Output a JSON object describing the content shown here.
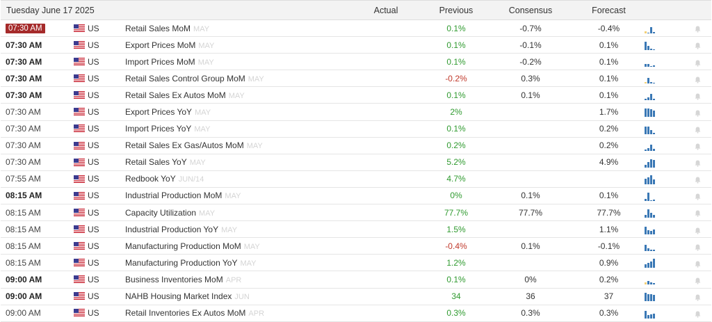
{
  "header": {
    "date": "Tuesday June 17 2025",
    "col_actual": "Actual",
    "col_previous": "Previous",
    "col_consensus": "Consensus",
    "col_forecast": "Forecast"
  },
  "colors": {
    "positive": "#2f9a2f",
    "negative": "#c0392b",
    "badge": "#a52a2a",
    "spark_blue": "#3a78b5",
    "spark_yellow": "#f2d077"
  },
  "flag_icon": "us-flag-icon",
  "bell_icon": "bell-icon",
  "rows": [
    {
      "time": "07:30 AM",
      "time_style": "badge",
      "country": "US",
      "event": "Retail Sales MoM",
      "ref": "MAY",
      "actual": "",
      "previous": "0.1%",
      "prev_sign": "pos",
      "consensus": "-0.7%",
      "forecast": "-0.4%",
      "spark": [
        3,
        0,
        9,
        2
      ]
    },
    {
      "time": "07:30 AM",
      "time_style": "bold",
      "country": "US",
      "event": "Export Prices MoM",
      "ref": "MAY",
      "actual": "",
      "previous": "0.1%",
      "prev_sign": "pos",
      "consensus": "-0.1%",
      "forecast": "0.1%",
      "spark": [
        12,
        6,
        2,
        1
      ]
    },
    {
      "time": "07:30 AM",
      "time_style": "bold",
      "country": "US",
      "event": "Import Prices MoM",
      "ref": "MAY",
      "actual": "",
      "previous": "0.1%",
      "prev_sign": "pos",
      "consensus": "-0.2%",
      "forecast": "0.1%",
      "spark": [
        4,
        4,
        1,
        2
      ]
    },
    {
      "time": "07:30 AM",
      "time_style": "bold",
      "country": "US",
      "event": "Retail Sales Control Group MoM",
      "ref": "MAY",
      "actual": "",
      "previous": "-0.2%",
      "prev_sign": "neg",
      "consensus": "0.3%",
      "forecast": "0.1%",
      "spark": [
        2,
        8,
        2,
        1
      ]
    },
    {
      "time": "07:30 AM",
      "time_style": "bold",
      "country": "US",
      "event": "Retail Sales Ex Autos MoM",
      "ref": "MAY",
      "actual": "",
      "previous": "0.1%",
      "prev_sign": "pos",
      "consensus": "0.1%",
      "forecast": "0.1%",
      "spark": [
        2,
        4,
        9,
        2
      ]
    },
    {
      "time": "07:30 AM",
      "time_style": "normal",
      "country": "US",
      "event": "Export Prices YoY",
      "ref": "MAY",
      "actual": "",
      "previous": "2%",
      "prev_sign": "pos",
      "consensus": "",
      "forecast": "1.7%",
      "spark": [
        12,
        12,
        11,
        9
      ]
    },
    {
      "time": "07:30 AM",
      "time_style": "normal",
      "country": "US",
      "event": "Import Prices YoY",
      "ref": "MAY",
      "actual": "",
      "previous": "0.1%",
      "prev_sign": "pos",
      "consensus": "",
      "forecast": "0.2%",
      "spark": [
        11,
        11,
        6,
        2
      ]
    },
    {
      "time": "07:30 AM",
      "time_style": "normal",
      "country": "US",
      "event": "Retail Sales Ex Gas/Autos MoM",
      "ref": "MAY",
      "actual": "",
      "previous": "0.2%",
      "prev_sign": "pos",
      "consensus": "",
      "forecast": "0.2%",
      "spark": [
        2,
        4,
        9,
        3
      ]
    },
    {
      "time": "07:30 AM",
      "time_style": "normal",
      "country": "US",
      "event": "Retail Sales YoY",
      "ref": "MAY",
      "actual": "",
      "previous": "5.2%",
      "prev_sign": "pos",
      "consensus": "",
      "forecast": "4.9%",
      "spark": [
        4,
        8,
        12,
        11
      ]
    },
    {
      "time": "07:55 AM",
      "time_style": "normal",
      "country": "US",
      "event": "Redbook YoY",
      "ref": "JUN/14",
      "actual": "",
      "previous": "4.7%",
      "prev_sign": "pos",
      "consensus": "",
      "forecast": "",
      "spark": [
        8,
        10,
        13,
        7
      ]
    },
    {
      "time": "08:15 AM",
      "time_style": "bold",
      "country": "US",
      "event": "Industrial Production MoM",
      "ref": "MAY",
      "actual": "",
      "previous": "0%",
      "prev_sign": "pos",
      "consensus": "0.1%",
      "forecast": "0.1%",
      "spark": [
        3,
        12,
        1,
        2
      ]
    },
    {
      "time": "08:15 AM",
      "time_style": "normal",
      "country": "US",
      "event": "Capacity Utilization",
      "ref": "MAY",
      "actual": "",
      "previous": "77.7%",
      "prev_sign": "pos",
      "consensus": "77.7%",
      "forecast": "77.7%",
      "spark": [
        4,
        12,
        7,
        4
      ]
    },
    {
      "time": "08:15 AM",
      "time_style": "normal",
      "country": "US",
      "event": "Industrial Production YoY",
      "ref": "MAY",
      "actual": "",
      "previous": "1.5%",
      "prev_sign": "pos",
      "consensus": "",
      "forecast": "1.1%",
      "spark": [
        11,
        6,
        5,
        7
      ]
    },
    {
      "time": "08:15 AM",
      "time_style": "normal",
      "country": "US",
      "event": "Manufacturing Production MoM",
      "ref": "MAY",
      "actual": "",
      "previous": "-0.4%",
      "prev_sign": "neg",
      "consensus": "0.1%",
      "forecast": "-0.1%",
      "spark": [
        9,
        4,
        2,
        2
      ]
    },
    {
      "time": "08:15 AM",
      "time_style": "normal",
      "country": "US",
      "event": "Manufacturing Production YoY",
      "ref": "MAY",
      "actual": "",
      "previous": "1.2%",
      "prev_sign": "pos",
      "consensus": "",
      "forecast": "0.9%",
      "spark": [
        5,
        7,
        9,
        13
      ]
    },
    {
      "time": "09:00 AM",
      "time_style": "bold",
      "country": "US",
      "event": "Business Inventories MoM",
      "ref": "APR",
      "actual": "",
      "previous": "0.1%",
      "prev_sign": "pos",
      "consensus": "0%",
      "forecast": "0.2%",
      "spark": [
        3,
        5,
        3,
        2
      ]
    },
    {
      "time": "09:00 AM",
      "time_style": "bold",
      "country": "US",
      "event": "NAHB Housing Market Index",
      "ref": "JUN",
      "actual": "",
      "previous": "34",
      "prev_sign": "pos",
      "consensus": "36",
      "forecast": "37",
      "spark": [
        12,
        10,
        10,
        9
      ]
    },
    {
      "time": "09:00 AM",
      "time_style": "normal",
      "country": "US",
      "event": "Retail Inventories Ex Autos MoM",
      "ref": "APR",
      "actual": "",
      "previous": "0.3%",
      "prev_sign": "pos",
      "consensus": "0.3%",
      "forecast": "0.3%",
      "spark": [
        11,
        5,
        6,
        7
      ]
    }
  ]
}
